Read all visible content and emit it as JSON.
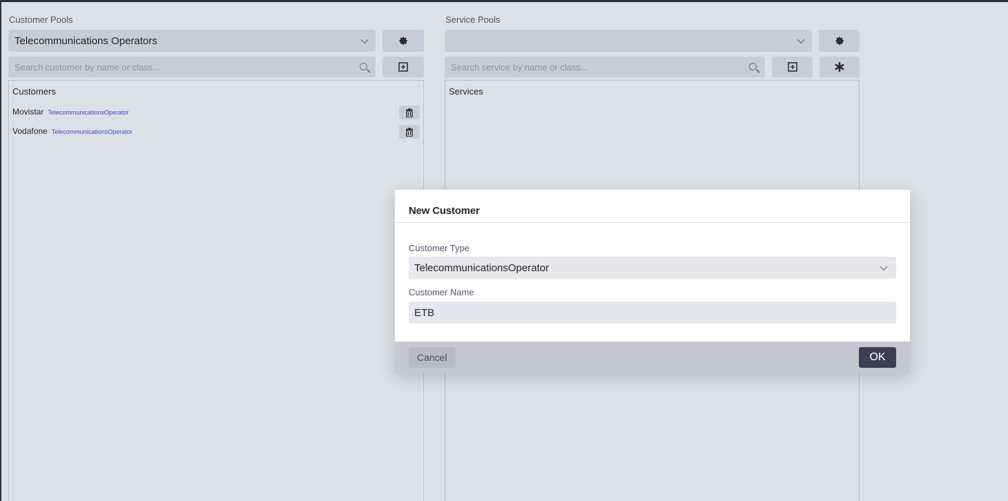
{
  "customer_pools": {
    "label": "Customer Pools",
    "selected": "Telecommunications Operators",
    "search_placeholder": "Search customer by name or class...",
    "panel_title": "Customers",
    "customers": [
      {
        "name": "Movistar",
        "class": "TelecommunicationsOperator"
      },
      {
        "name": "Vodafone",
        "class": "TelecommunicationsOperator"
      }
    ]
  },
  "service_pools": {
    "label": "Service Pools",
    "selected": "",
    "search_placeholder": "Search service by name or class...",
    "panel_title": "Services"
  },
  "dialog": {
    "title": "New Customer",
    "type_label": "Customer Type",
    "type_value": "TelecommunicationsOperator",
    "name_label": "Customer Name",
    "name_value": "ETB",
    "cancel_label": "Cancel",
    "ok_label": "OK"
  },
  "icons": {
    "settings": "gear-icon",
    "add": "plus-square-icon",
    "asterisk": "asterisk-icon",
    "delete": "trash-icon",
    "search": "search-icon",
    "dropdown": "chevron-down-icon"
  },
  "colors": {
    "background": "#dde1e6",
    "control": "#c8ccd6",
    "class_link": "#3a4bc8",
    "primary_button": "#3d3f55"
  }
}
